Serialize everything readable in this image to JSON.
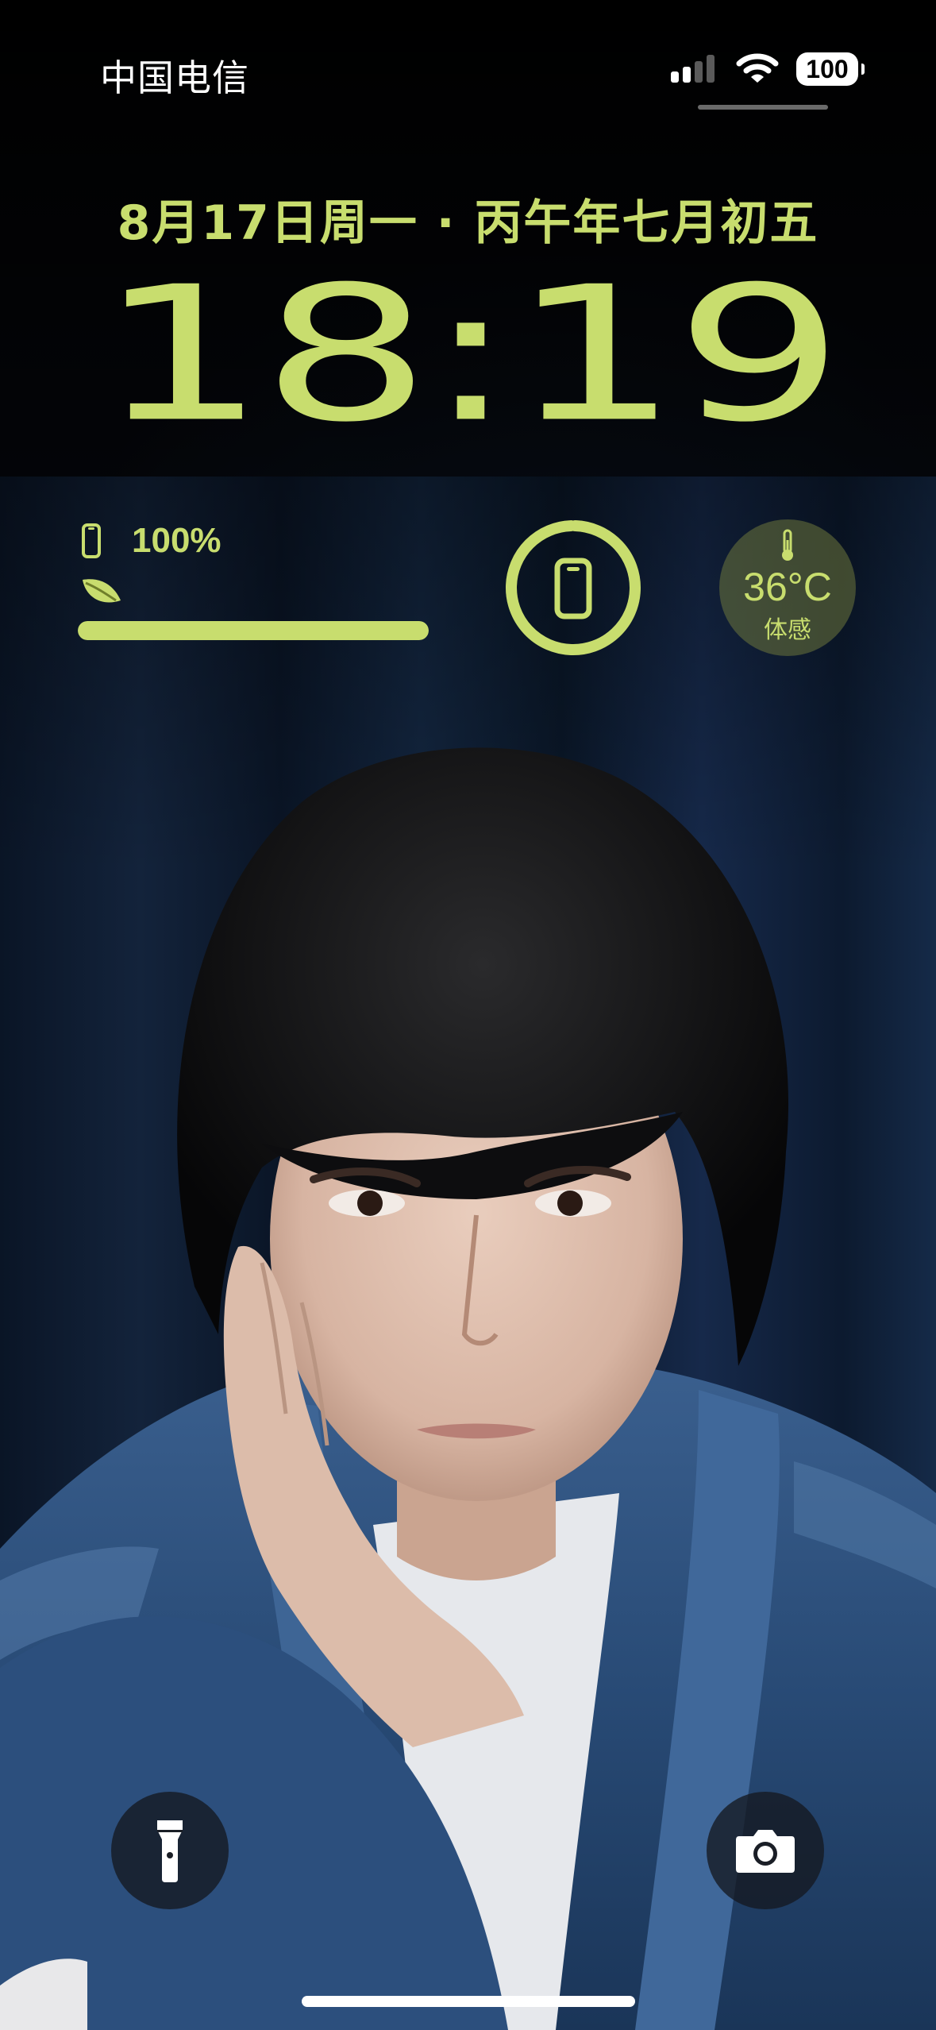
{
  "status_bar": {
    "carrier": "中国电信",
    "battery_level": "100",
    "signal_icon": "cellular-signal-icon",
    "wifi_icon": "wifi-icon"
  },
  "lock_screen": {
    "date": "8月17日周一 · 丙午年七月初五",
    "time": "18:19"
  },
  "widgets": {
    "battery": {
      "percent_text": "100%",
      "level": 1.0,
      "icons": [
        "phone-icon",
        "leaf-icon"
      ]
    },
    "device_ring": {
      "level": 1.0,
      "icon": "phone-icon"
    },
    "temperature": {
      "value": "36°C",
      "label": "体感",
      "icon": "thermometer-icon"
    }
  },
  "quick_actions": {
    "left": "flashlight-icon",
    "right": "camera-icon"
  },
  "colors": {
    "accent": "#c8dd6e",
    "text": "#ffffff",
    "background": "#05070c",
    "jacket": "#2e4d78"
  }
}
